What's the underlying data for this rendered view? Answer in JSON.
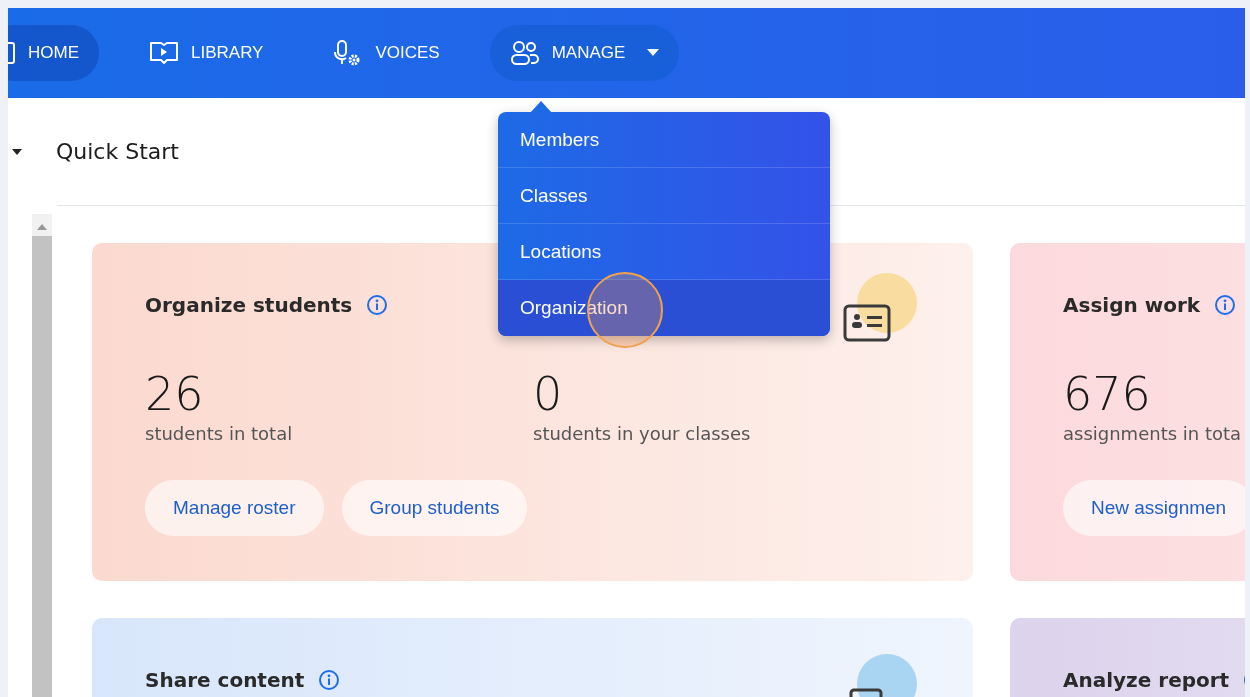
{
  "nav": {
    "items": [
      {
        "label": "HOME",
        "kind": "home",
        "selected": true,
        "expanded": false
      },
      {
        "label": "LIBRARY",
        "kind": "library",
        "selected": false,
        "expanded": false
      },
      {
        "label": "VOICES",
        "kind": "voices",
        "selected": false,
        "expanded": false
      },
      {
        "label": "MANAGE",
        "kind": "manage",
        "selected": false,
        "expanded": true
      }
    ]
  },
  "manage_menu": {
    "items": [
      {
        "label": "Members",
        "selected": false
      },
      {
        "label": "Classes",
        "selected": false
      },
      {
        "label": "Locations",
        "selected": false
      },
      {
        "label": "Organization",
        "selected": true
      }
    ]
  },
  "section": {
    "title": "Quick Start",
    "expanded": true
  },
  "cards": [
    {
      "title": "Organize students",
      "color": "#fbd9cf",
      "kind": "id-card",
      "stats": [
        {
          "value": "26",
          "label": "students in total"
        },
        {
          "value": "0",
          "label": "students in your classes"
        }
      ],
      "buttons": [
        "Manage roster",
        "Group students"
      ]
    },
    {
      "title": "Assign work",
      "color": "#fcd9dc",
      "kind": "plain",
      "stats": [
        {
          "value": "676",
          "label": "assignments in tota"
        }
      ],
      "buttons": [
        "New assignmen"
      ]
    },
    {
      "title": "Share content",
      "color": "#d8e6fb",
      "kind": "frame"
    },
    {
      "title": "Analyze report",
      "color": "#dcd3ec",
      "kind": "plain"
    }
  ]
}
